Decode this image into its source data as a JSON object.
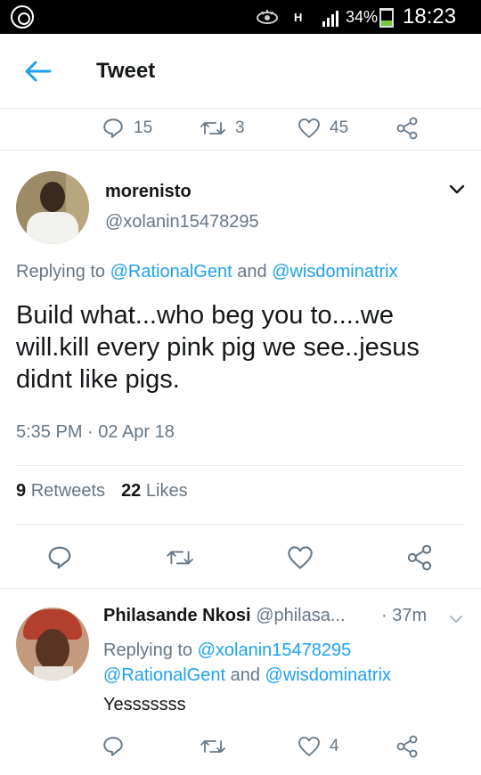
{
  "status_bar": {
    "battery_percent": "34%",
    "battery_level": 0.34,
    "network": "H",
    "time": "18:23",
    "icons": [
      "app-notification-icon",
      "eye-icon",
      "signal-icon",
      "battery-icon"
    ]
  },
  "header": {
    "title": "Tweet",
    "back_icon": "arrow-left-icon"
  },
  "parent_actions": {
    "replies": "15",
    "retweets": "3",
    "likes": "45"
  },
  "tweet": {
    "author_name": "morenisto",
    "author_handle": "@xolanin15478295",
    "replying_prefix": "Replying to",
    "replying_user_1": "@RationalGent",
    "replying_and": "and",
    "replying_user_2": "@wisdominatrix",
    "text": "Build what...who beg you to....we will.kill every pink pig we see..jesus didnt like pigs.",
    "timestamp": "5:35 PM · 02 Apr 18",
    "retweet_count": "9",
    "retweet_label": "Retweets",
    "like_count": "22",
    "like_label": "Likes"
  },
  "reply": {
    "author_name": "Philasande Nkosi",
    "author_handle": "@philasa...",
    "time": "· 37m",
    "replying_prefix": "Replying to",
    "replying_user_1": "@xolanin15478295",
    "replying_user_2": "@RationalGent",
    "replying_and": "and",
    "replying_user_3": "@wisdominatrix",
    "text": "Yesssssss",
    "likes": "4"
  },
  "colors": {
    "accent": "#1da1f2",
    "muted": "#657786",
    "text": "#14171a",
    "divider": "#e6ecf0"
  }
}
